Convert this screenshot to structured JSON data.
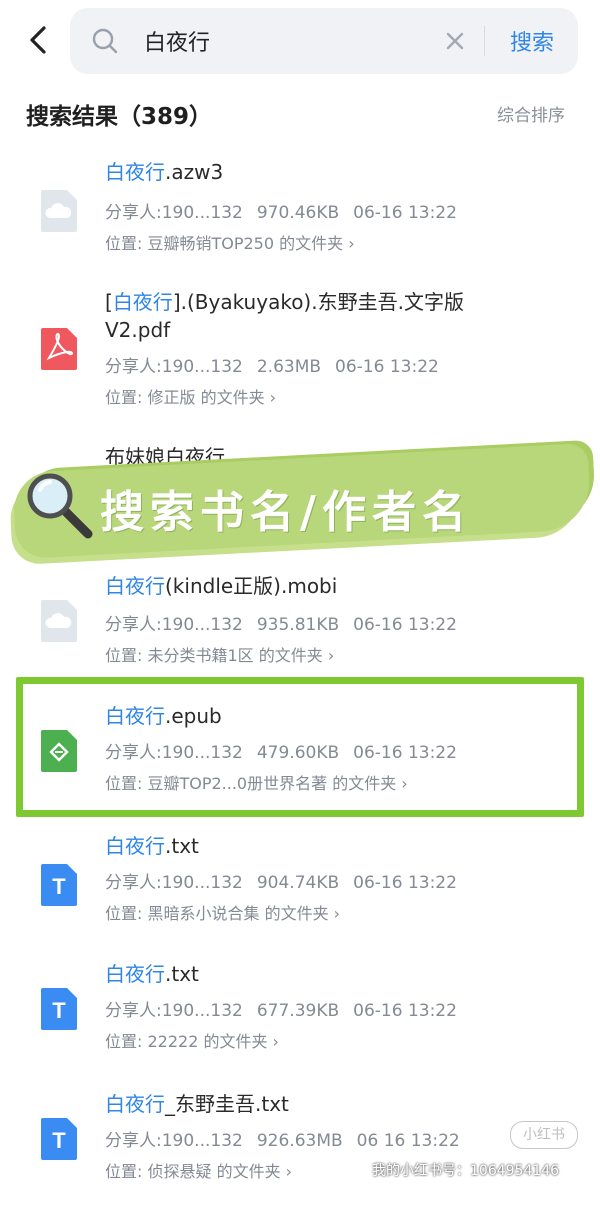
{
  "search": {
    "query": "白夜行",
    "button_label": "搜索"
  },
  "results": {
    "title": "搜索结果（389）",
    "sort_label": "综合排序"
  },
  "files": [
    {
      "highlight": "白夜行",
      "name_pre": "",
      "name_post": ".azw3",
      "name_line2": "",
      "sharer": "分享人:190...132",
      "size": "970.46KB",
      "date": "06-16 13:22",
      "location": "位置:  豆瓣畅销TOP250 的文件夹 ›",
      "icon": "cloud-file-icon"
    },
    {
      "highlight": "白夜行",
      "name_pre": "[",
      "name_post": "].(Byakuyako).东野圭吾.文字版",
      "name_line2": "V2.pdf",
      "sharer": "分享人:190...132",
      "size": "2.63MB",
      "date": "06-16 13:22",
      "location": "位置:  修正版 的文件夹 ›",
      "icon": "pdf-file-icon"
    },
    {
      "highlight": "白夜行",
      "name_pre": "",
      "name_post": "(kindle正版).mobi",
      "name_line2": "",
      "sharer": "分享人:190...132",
      "size": "935.81KB",
      "date": "06-16 13:22",
      "location": "位置:  未分类书籍1区 的文件夹 ›",
      "icon": "cloud-file-icon"
    },
    {
      "highlight": "白夜行",
      "name_pre": "",
      "name_post": ".epub",
      "name_line2": "",
      "sharer": "分享人:190...132",
      "size": "479.60KB",
      "date": "06-16 13:22",
      "location": "位置:  豆瓣TOP2...0册世界名著 的文件夹 ›",
      "icon": "epub-file-icon"
    },
    {
      "highlight": "白夜行",
      "name_pre": "",
      "name_post": ".txt",
      "name_line2": "",
      "sharer": "分享人:190...132",
      "size": "904.74KB",
      "date": "06-16 13:22",
      "location": "位置:  黑暗系小说合集 的文件夹 ›",
      "icon": "txt-file-icon"
    },
    {
      "highlight": "白夜行",
      "name_pre": "",
      "name_post": ".txt",
      "name_line2": "",
      "sharer": "分享人:190...132",
      "size": "677.39KB",
      "date": "06-16 13:22",
      "location": "位置:  22222 的文件夹 ›",
      "icon": "txt-file-icon"
    },
    {
      "highlight": "白夜行",
      "name_pre": "",
      "name_post": "_东野圭吾.txt",
      "name_line2": "",
      "sharer": "分享人:190...132",
      "size": "926.63MB",
      "date": "06 16 13:22",
      "location": "位置:  侦探悬疑 的文件夹 ›",
      "icon": "txt-file-icon"
    }
  ],
  "partial_item_text": "布妹娘白夜行",
  "banner": {
    "text": "搜索书名/作者名",
    "brush_color": "#b8d67a"
  },
  "highlight_color": "#7ec832",
  "accent_color": "#2f86e6",
  "watermark": {
    "badge": "小红书",
    "id_text": "我的小红书号：1064954146"
  }
}
